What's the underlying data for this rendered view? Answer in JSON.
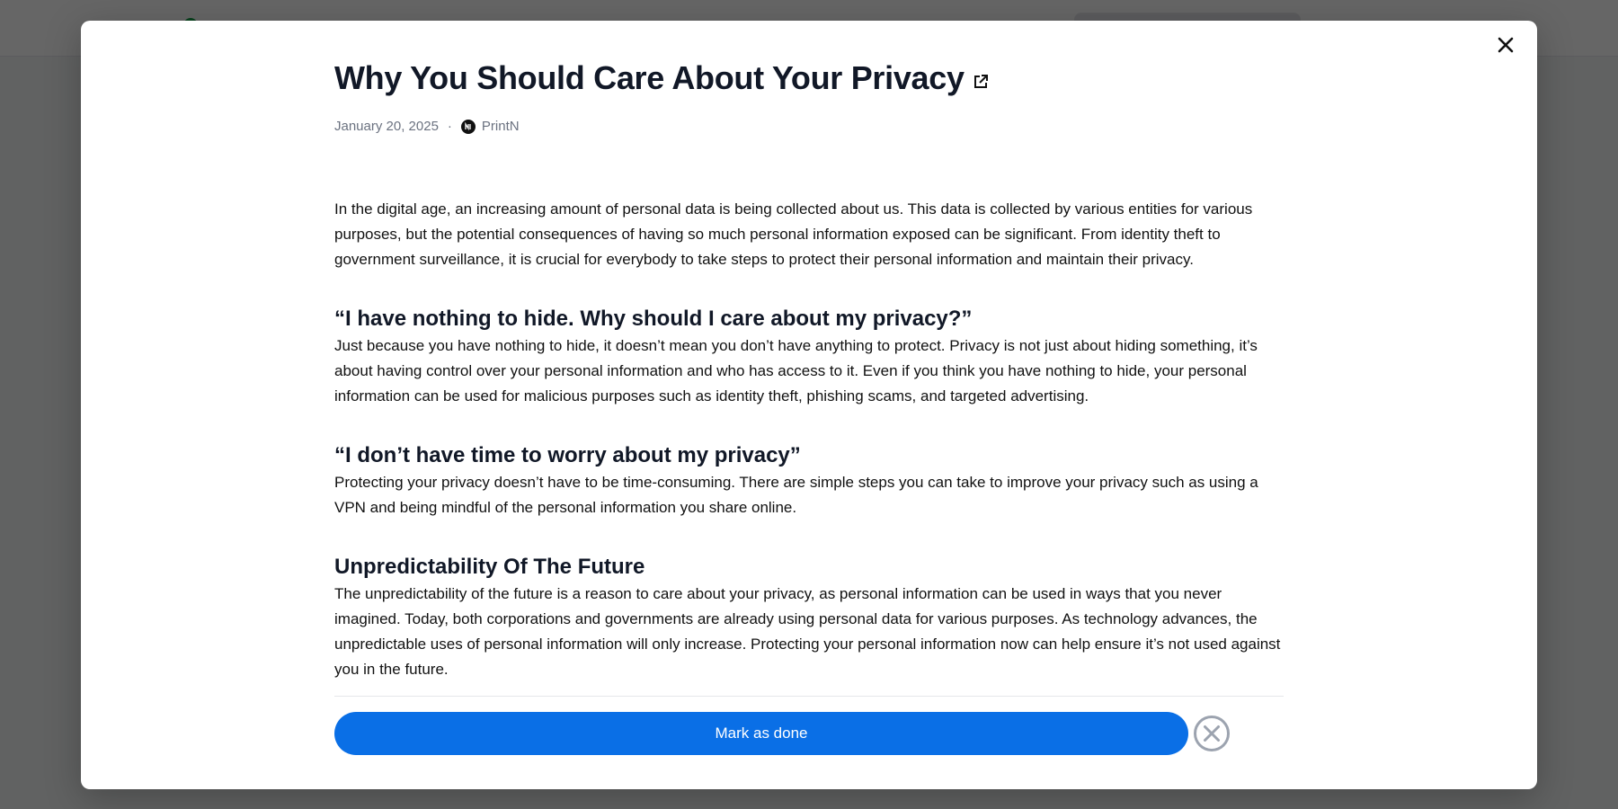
{
  "article": {
    "title": "Why You Should Care About Your Privacy",
    "date": "January 20, 2025",
    "separator": "·",
    "source": "PrintN",
    "sections": [
      {
        "heading": "",
        "body": "In the digital age, an increasing amount of personal data is being collected about us. This data is collected by various entities for various purposes, but the potential consequences of having so much personal information exposed can be significant. From identity theft to government surveillance, it is crucial for everybody to take steps to protect their personal information and maintain their privacy."
      },
      {
        "heading": "“I have nothing to hide. Why should I care about my privacy?”",
        "body": "Just because you have nothing to hide, it doesn’t mean you don’t have anything to protect. Privacy is not just about hiding something, it’s about having control over your personal information and who has access to it. Even if you think you have nothing to hide, your personal information can be used for malicious purposes such as identity theft, phishing scams, and targeted advertising."
      },
      {
        "heading": "“I don’t have time to worry about my privacy”",
        "body": "Protecting your privacy doesn’t have to be time-consuming. There are simple steps you can take to improve your privacy such as using a VPN and being mindful of the personal information you share online."
      },
      {
        "heading": "Unpredictability Of The Future",
        "body": "The unpredictability of the future is a reason to care about your privacy, as personal information can be used in ways that you never imagined. Today, both corporations and governments are already using personal data for various purposes. As technology advances, the unpredictable uses of personal information will only increase. Protecting your personal information now can help ensure it’s not used against you in the future."
      }
    ]
  },
  "actions": {
    "done_label": "Mark as done"
  },
  "icons": {
    "close": "close-icon",
    "external_link": "external-link-icon",
    "source": "source-logo-icon",
    "dismiss": "circle-x-icon"
  },
  "colors": {
    "primary_button": "#0a6fe6",
    "overlay": "rgba(0,0,0,0.6)",
    "title": "#111827",
    "meta": "#6b7280"
  }
}
